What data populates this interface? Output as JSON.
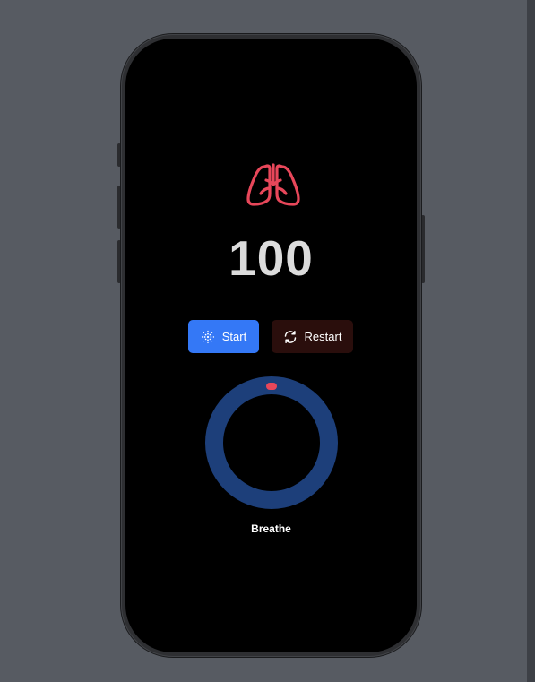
{
  "app": {
    "counter": "100",
    "start_label": "Start",
    "restart_label": "Restart",
    "phase_label": "Breathe"
  },
  "icons": {
    "lungs": "lungs-icon",
    "start": "breathing-sparkle-icon",
    "restart": "arrows-cycle-icon"
  },
  "progress": {
    "fraction": 0.0
  },
  "colors": {
    "background": "#575b62",
    "screen": "#000000",
    "accent_red": "#e8475a",
    "start_button": "#3478f6",
    "restart_button": "#2a0e0c",
    "ring": "#1d3f7a",
    "counter_text": "#dcdcdc"
  }
}
